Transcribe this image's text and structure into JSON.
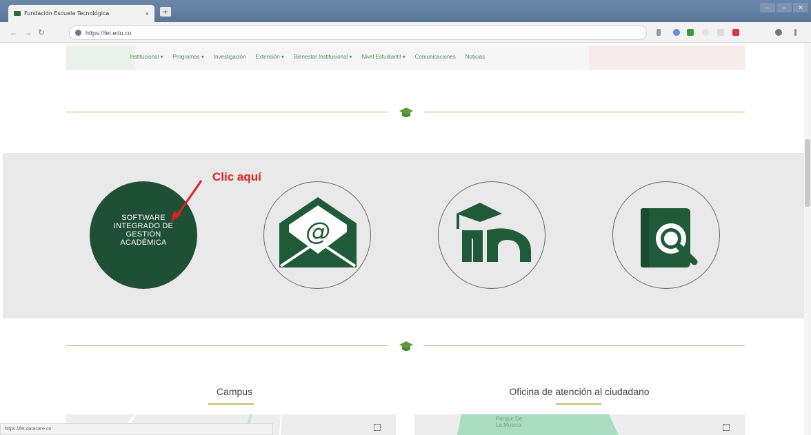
{
  "browser": {
    "tab_title": "Fundación Escuela Tecnológica",
    "tab_close": "×",
    "new_tab": "+",
    "address": "https://fet.edu.co",
    "status_url": "https://fet.datacare.co"
  },
  "site_nav": {
    "items": [
      {
        "label": "Institucional ▾"
      },
      {
        "label": "Programas ▾"
      },
      {
        "label": "Investigación"
      },
      {
        "label": "Extensión ▾"
      },
      {
        "label": "Bienestar Institucional ▾"
      },
      {
        "label": "Nivel Estudiantil ▾"
      },
      {
        "label": "Comunicaciones"
      },
      {
        "label": "Noticias"
      }
    ]
  },
  "annotation": {
    "text": "Clic aquí",
    "color": "#e02020"
  },
  "quick_links": {
    "sis": {
      "line1": "SOFTWARE",
      "line2": "INTEGRADO DE",
      "line3": "GESTIÓN",
      "line4": "ACADÉMICA"
    }
  },
  "sections": {
    "campus_title": "Campus",
    "office_title": "Oficina de atención al ciudadano",
    "map_label_line1": "Parque De",
    "map_label_line2": "La Música"
  },
  "colors": {
    "brand_green": "#1f4f34",
    "accent_line": "#a8c27a",
    "cap_green": "#5c9a3a"
  }
}
